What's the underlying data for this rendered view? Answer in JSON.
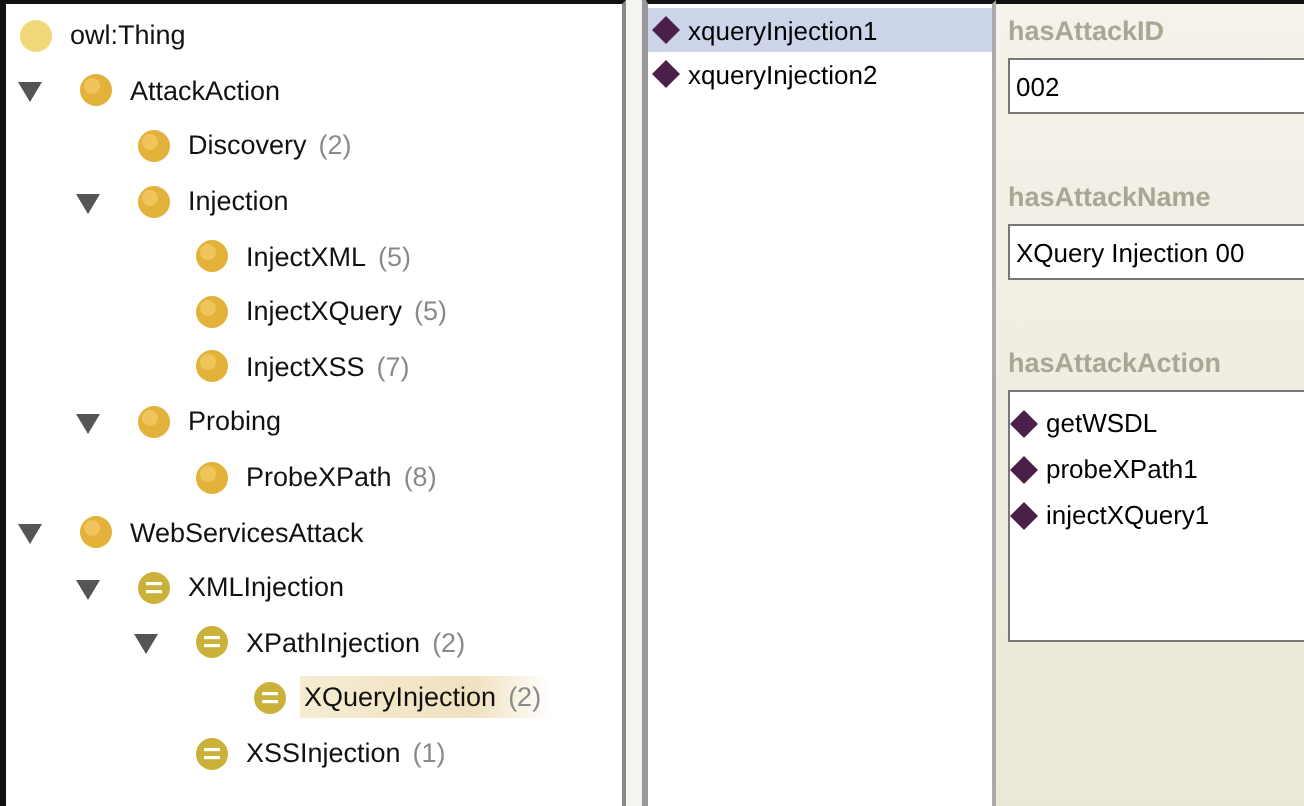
{
  "class_tree": [
    {
      "label": "owl:Thing",
      "kind": "root",
      "selected": false
    },
    {
      "label": "AttackAction",
      "kind": "class",
      "expanded": true,
      "selected": false,
      "children": [
        {
          "label": "Discovery",
          "count": "(2)",
          "kind": "class",
          "selected": false
        },
        {
          "label": "Injection",
          "kind": "class",
          "expanded": true,
          "selected": false,
          "children": [
            {
              "label": "InjectXML",
              "count": "(5)",
              "kind": "class",
              "selected": false
            },
            {
              "label": "InjectXQuery",
              "count": "(5)",
              "kind": "class",
              "selected": false
            },
            {
              "label": "InjectXSS",
              "count": "(7)",
              "kind": "class",
              "selected": false
            }
          ]
        },
        {
          "label": "Probing",
          "kind": "class",
          "expanded": true,
          "selected": false,
          "children": [
            {
              "label": "ProbeXPath",
              "count": "(8)",
              "kind": "class",
              "selected": false
            }
          ]
        }
      ]
    },
    {
      "label": "WebServicesAttack",
      "kind": "class",
      "expanded": true,
      "selected": false,
      "children": [
        {
          "label": "XMLInjection",
          "kind": "defined",
          "expanded": true,
          "selected": false,
          "children": [
            {
              "label": "XPathInjection",
              "count": "(2)",
              "kind": "defined",
              "expanded": true,
              "selected": false,
              "children": [
                {
                  "label": "XQueryInjection",
                  "count": "(2)",
                  "kind": "defined",
                  "selected": true
                }
              ]
            },
            {
              "label": "XSSInjection",
              "count": "(1)",
              "kind": "defined",
              "selected": false
            }
          ]
        }
      ]
    }
  ],
  "instances": [
    {
      "label": "xqueryInjection1",
      "selected": true
    },
    {
      "label": "xqueryInjection2",
      "selected": false
    }
  ],
  "properties": [
    {
      "label": "hasAttackID",
      "kind": "text",
      "value": "002"
    },
    {
      "label": "hasAttackName",
      "kind": "text",
      "value": "XQuery Injection 00"
    },
    {
      "label": "hasAttackAction",
      "kind": "list",
      "items": [
        "getWSDL",
        "probeXPath1",
        "injectXQuery1"
      ]
    }
  ]
}
